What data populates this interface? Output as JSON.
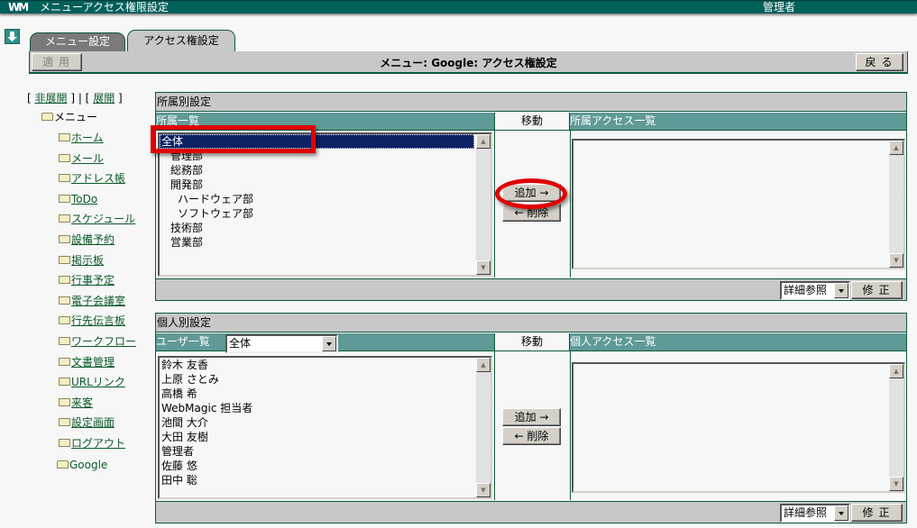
{
  "app": {
    "logo": "WM",
    "title": "メニューアクセス権限設定",
    "user": "管理者"
  },
  "tabs": [
    {
      "label": "メニュー設定",
      "active": false
    },
    {
      "label": "アクセス権設定",
      "active": true
    }
  ],
  "toolbar": {
    "apply_label": "適用",
    "heading": "メニュー: Google: アクセス権設定",
    "back_label": "戻る"
  },
  "tree": {
    "collapse_label": "非展開",
    "expand_label": "展開",
    "root_label": "メニュー",
    "items": [
      "ホーム",
      "メール",
      "アドレス帳",
      "ToDo",
      "スケジュール",
      "設備予約",
      "掲示板",
      "行事予定",
      "電子会議室",
      "行先伝言板",
      "ワークフロー",
      "文書管理",
      "URLリンク",
      "来客",
      "設定画面",
      "ログアウト"
    ],
    "current": "Google"
  },
  "group_panel": {
    "title": "所属別設定",
    "list_header": "所属一覧",
    "move_header": "移動",
    "access_header": "所属アクセス一覧",
    "groups": [
      {
        "label": "全体",
        "selected": true,
        "level": 0
      },
      {
        "label": "管理部",
        "selected": false,
        "level": 1
      },
      {
        "label": "総務部",
        "selected": false,
        "level": 1
      },
      {
        "label": "開発部",
        "selected": false,
        "level": 1
      },
      {
        "label": "ハードウェア部",
        "selected": false,
        "level": 2
      },
      {
        "label": "ソフトウェア部",
        "selected": false,
        "level": 2
      },
      {
        "label": "技術部",
        "selected": false,
        "level": 1
      },
      {
        "label": "営業部",
        "selected": false,
        "level": 1
      }
    ],
    "access_list": [],
    "add_label": "追加 →",
    "remove_label": "← 削除",
    "view_select": "詳細参照",
    "edit_label": "修正"
  },
  "user_panel": {
    "title": "個人別設定",
    "list_header": "ユーザ一覧",
    "filter_select": "全体",
    "move_header": "移動",
    "access_header": "個人アクセス一覧",
    "users": [
      "鈴木 友香",
      "上原 さとみ",
      "高橋 希",
      "WebMagic 担当者",
      "池間 大介",
      "大田 友樹",
      "管理者",
      "佐藤 悠",
      "田中 聡"
    ],
    "access_list": [],
    "add_label": "追加 →",
    "remove_label": "← 削除",
    "view_select": "詳細参照",
    "edit_label": "修正"
  },
  "annotations": {
    "highlight_color": "#e00000"
  }
}
